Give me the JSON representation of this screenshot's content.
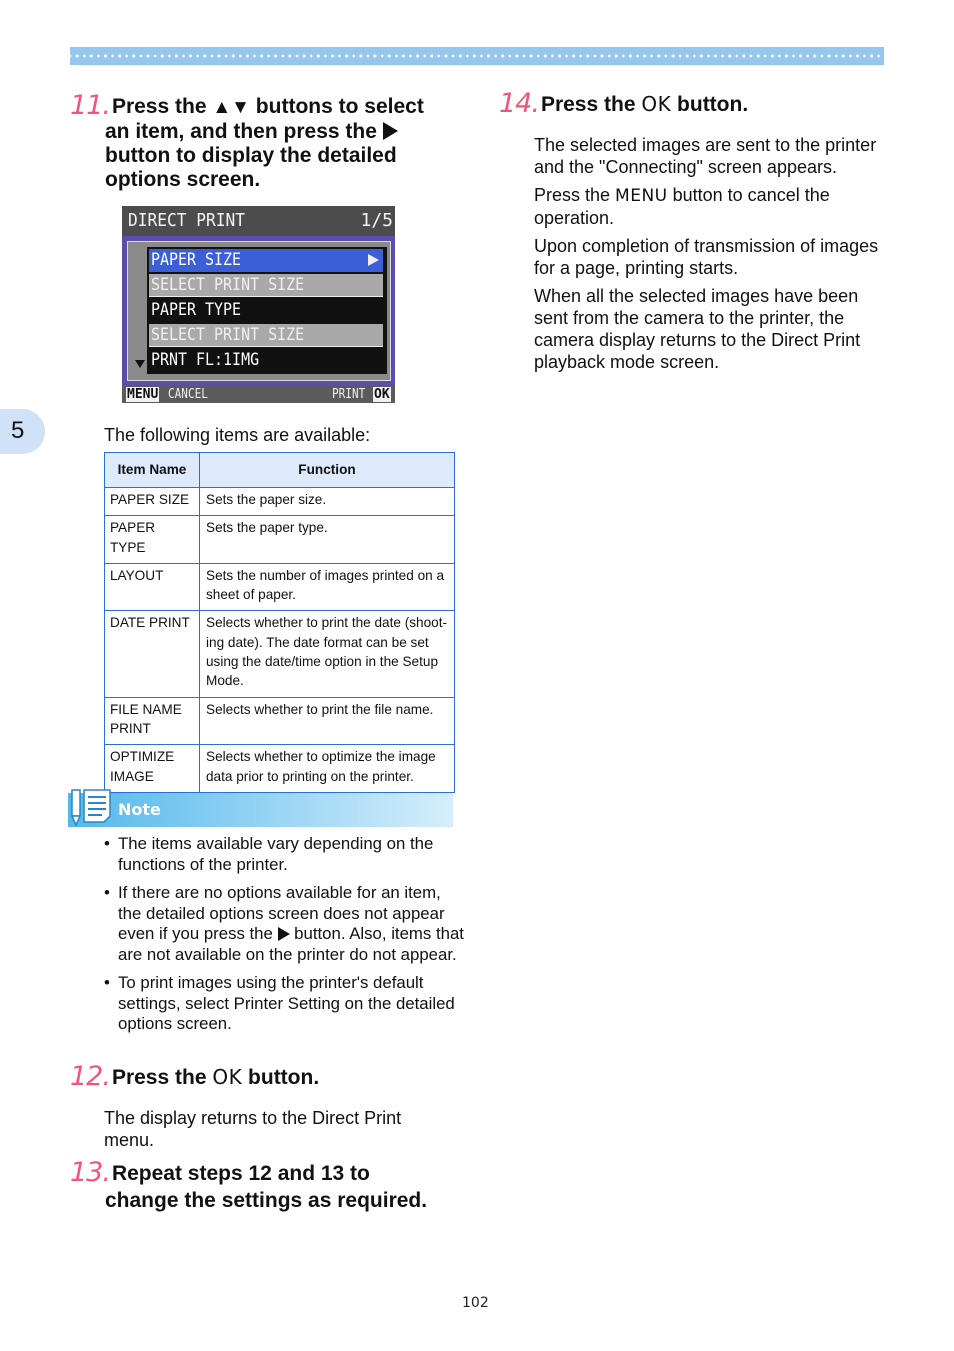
{
  "steps": {
    "s11": {
      "number": "11.",
      "line1_a": "Press the ",
      "line1_b": " buttons to select",
      "line2": "an item, and then press the ",
      "line3": "button to display the detailed",
      "line4": "options screen."
    },
    "s12": {
      "number": "12.",
      "pre": "Press the ",
      "key": "OK",
      "post": " button.",
      "body": [
        "The display returns to the Direct Print menu."
      ]
    },
    "s13": {
      "number": "13.",
      "line1": "Repeat steps 12 and 13 to",
      "line2": "change the settings as required."
    },
    "s14": {
      "number": "14.",
      "pre": "Press the ",
      "key": "OK",
      "post": " button.",
      "body": [
        "The selected images are sent to the printer and the \"Connecting\" screen appears.",
        "Upon completion of transmission of images for a page, printing starts.",
        "When all the selected images have been sent from the camera to the printer, the camera display returns to the Direct Print playback mode screen."
      ],
      "menu_para": {
        "pre": "Press the ",
        "key": "MENU",
        "post": " button to cancel the operation."
      }
    }
  },
  "camera_screen": {
    "title": "DIRECT PRINT",
    "page": "1/5",
    "rows": [
      {
        "label": "PAPER SIZE",
        "state": "selected"
      },
      {
        "label": "SELECT PRINT SIZE",
        "state": "sub"
      },
      {
        "label": "PAPER TYPE",
        "state": "normal"
      },
      {
        "label": "SELECT PRINT SIZE",
        "state": "sub"
      },
      {
        "label": "PRNT FL:1IMG",
        "state": "normal"
      }
    ],
    "bottom_left_key": "MENU",
    "bottom_left_text": "CANCEL",
    "bottom_right_text": "PRINT",
    "bottom_right_key": "OK"
  },
  "chapter": "5",
  "intro": "The following items are available:",
  "table": {
    "headers": [
      "Item Name",
      "Function"
    ],
    "rows": [
      [
        "PAPER SIZE",
        "Sets the paper size."
      ],
      [
        "PAPER TYPE",
        "Sets the paper type."
      ],
      [
        "LAYOUT",
        "Sets the number of images printed on a sheet of paper."
      ],
      [
        "DATE PRINT",
        "Selects whether to print the date (shoot-ing date). The date format can be set using the date/time option in the Setup Mode."
      ],
      [
        "FILE NAME PRINT",
        "Selects whether to print the file name."
      ],
      [
        "OPTIMIZE IMAGE",
        "Selects whether to optimize the image data prior to printing on the printer."
      ]
    ]
  },
  "note": {
    "label": "Note",
    "bullets": [
      {
        "text": "The items available vary depending on the functions of the printer."
      },
      {
        "pre": "If there are no options available for an item, the detailed options screen does not appear even if you press the ",
        "post": " button. Also, items that are not available on the printer do not appear."
      },
      {
        "text": "To print images using the printer's default settings, select Printer Setting on the detailed options screen."
      }
    ],
    "bullet_char": "•"
  },
  "page_number": "102",
  "colors": {
    "step_number": "#f2557a",
    "band": "#95c7ec",
    "table_border": "#2a6fd1",
    "table_header": "#ddeafb",
    "note_blue": "#54b8ec"
  }
}
